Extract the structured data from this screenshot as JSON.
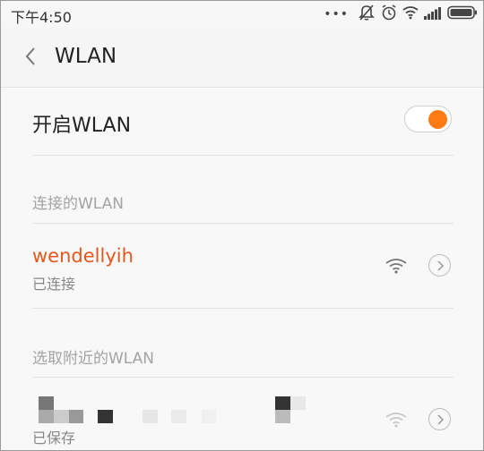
{
  "status_bar": {
    "time": "下午4:50",
    "icons": [
      "more-dots-icon",
      "mute-icon",
      "alarm-icon",
      "wifi-icon",
      "signal-icon",
      "battery-icon"
    ]
  },
  "header": {
    "title": "WLAN"
  },
  "wlan_toggle": {
    "label": "开启WLAN",
    "on": true
  },
  "connected_section": {
    "title": "连接的WLAN",
    "networks": [
      {
        "ssid": "wendellyih",
        "status": "已连接"
      }
    ]
  },
  "available_section": {
    "title": "选取附近的WLAN",
    "networks": [
      {
        "status": "已保存"
      }
    ]
  },
  "colors": {
    "accent": "#ff7a14",
    "ssid_connected": "#e2571d",
    "section_text": "#a3a3a3"
  }
}
